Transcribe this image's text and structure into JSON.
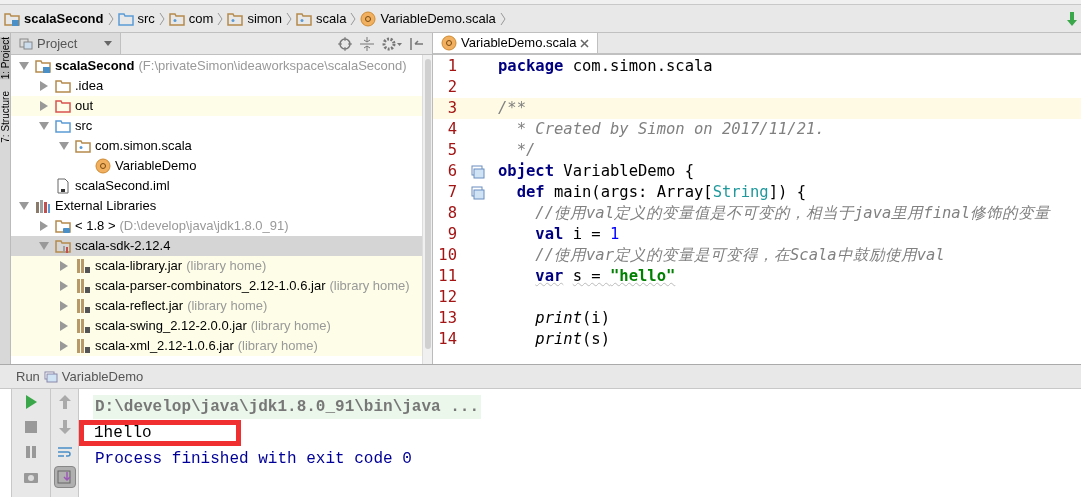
{
  "breadcrumbs": [
    {
      "label": "scalaSecond",
      "kind": "project"
    },
    {
      "label": "src",
      "kind": "source"
    },
    {
      "label": "com",
      "kind": "package"
    },
    {
      "label": "simon",
      "kind": "package"
    },
    {
      "label": "scala",
      "kind": "package"
    },
    {
      "label": "VariableDemo.scala",
      "kind": "object"
    }
  ],
  "side_tabs": [
    "1: Project",
    "7: Structure"
  ],
  "project_panel": {
    "title": "Project",
    "tree": [
      {
        "label": "scalaSecond",
        "hint": "(F:\\privateSimon\\ideaworkspace\\scalaSecond)",
        "kind": "project",
        "expanded": true,
        "selected": false,
        "highlighted": false,
        "children": [
          {
            "label": ".idea",
            "kind": "folder",
            "expanded": false,
            "selected": false,
            "highlighted": false
          },
          {
            "label": "out",
            "kind": "excluded",
            "expanded": false,
            "selected": false,
            "highlighted": true
          },
          {
            "label": "src",
            "kind": "source",
            "expanded": true,
            "selected": false,
            "highlighted": false,
            "children": [
              {
                "label": "com.simon.scala",
                "kind": "package",
                "expanded": true,
                "selected": false,
                "highlighted": false,
                "children": [
                  {
                    "label": "VariableDemo",
                    "kind": "object",
                    "selected": false,
                    "highlighted": false
                  }
                ]
              }
            ]
          },
          {
            "label": "scalaSecond.iml",
            "kind": "file",
            "selected": false,
            "highlighted": false
          }
        ]
      },
      {
        "label": "External Libraries",
        "kind": "libraries",
        "expanded": true,
        "selected": false,
        "highlighted": false,
        "children": [
          {
            "label": "< 1.8 >",
            "hint": "(D:\\develop\\java\\jdk1.8.0_91)",
            "kind": "jdk",
            "expanded": false,
            "selected": false,
            "highlighted": false
          },
          {
            "label": "scala-sdk-2.12.4",
            "kind": "sdk",
            "expanded": true,
            "selected": true,
            "highlighted": false,
            "children": [
              {
                "label": "scala-library.jar",
                "hint": "(library home)",
                "kind": "jar",
                "expanded": false,
                "selected": false,
                "highlighted": true
              },
              {
                "label": "scala-parser-combinators_2.12-1.0.6.jar",
                "hint": "(library home)",
                "kind": "jar",
                "expanded": false,
                "selected": false,
                "highlighted": true
              },
              {
                "label": "scala-reflect.jar",
                "hint": "(library home)",
                "kind": "jar",
                "expanded": false,
                "selected": false,
                "highlighted": true
              },
              {
                "label": "scala-swing_2.12-2.0.0.jar",
                "hint": "(library home)",
                "kind": "jar",
                "expanded": false,
                "selected": false,
                "highlighted": true
              },
              {
                "label": "scala-xml_2.12-1.0.6.jar",
                "hint": "(library home)",
                "kind": "jar",
                "expanded": false,
                "selected": false,
                "highlighted": true
              }
            ]
          }
        ]
      }
    ]
  },
  "editor": {
    "tabs": [
      {
        "label": "VariableDemo.scala",
        "selected": true
      }
    ],
    "lines": [
      {
        "number": "1",
        "current": false,
        "gutter_icon": false,
        "tokens": [
          {
            "text": "package",
            "kind": "keyword"
          },
          {
            "text": " com.simon.scala",
            "kind": "plain"
          }
        ]
      },
      {
        "number": "2",
        "current": false,
        "gutter_icon": false
      },
      {
        "number": "3",
        "current": true,
        "gutter_icon": false,
        "tokens": [
          {
            "text": "/**",
            "kind": "comment"
          }
        ]
      },
      {
        "number": "4",
        "current": false,
        "gutter_icon": false,
        "tokens": [
          {
            "text": "  * Created by Simon on 2017/11/21.",
            "kind": "comment"
          }
        ]
      },
      {
        "number": "5",
        "current": false,
        "gutter_icon": false,
        "tokens": [
          {
            "text": "  */",
            "kind": "comment"
          }
        ]
      },
      {
        "number": "6",
        "current": false,
        "gutter_icon": true,
        "tokens": [
          {
            "text": "object",
            "kind": "keyword"
          },
          {
            "text": " VariableDemo {",
            "kind": "plain"
          }
        ]
      },
      {
        "number": "7",
        "current": false,
        "gutter_icon": true,
        "tokens": [
          {
            "text": "  def",
            "kind": "keyword"
          },
          {
            "text": " main(args: Array[",
            "kind": "plain"
          },
          {
            "text": "String",
            "kind": "type"
          },
          {
            "text": "]) {",
            "kind": "plain"
          }
        ]
      },
      {
        "number": "8",
        "current": false,
        "gutter_icon": false,
        "tokens": [
          {
            "text": "    //使用val定义的变量值是不可变的，相当于java里用final修饰的变量",
            "kind": "comment"
          }
        ]
      },
      {
        "number": "9",
        "current": false,
        "gutter_icon": false,
        "tokens": [
          {
            "text": "    val",
            "kind": "keyword"
          },
          {
            "text": " i = ",
            "kind": "plain"
          },
          {
            "text": "1",
            "kind": "number"
          }
        ]
      },
      {
        "number": "10",
        "current": false,
        "gutter_icon": false,
        "tokens": [
          {
            "text": "    //使用var定义的变量是可变得，在Scala中鼓励使用val",
            "kind": "comment"
          }
        ]
      },
      {
        "number": "11",
        "current": false,
        "gutter_icon": false,
        "tokens": [
          {
            "text": "    var",
            "kind": "keyword",
            "warning": true
          },
          {
            "text": " s = ",
            "kind": "plain",
            "warning": true
          },
          {
            "text": "\"hello\"",
            "kind": "string",
            "warning": true
          }
        ]
      },
      {
        "number": "12",
        "current": false,
        "gutter_icon": false
      },
      {
        "number": "13",
        "current": false,
        "gutter_icon": false,
        "tokens": [
          {
            "text": "    print",
            "kind": "call"
          },
          {
            "text": "(i)",
            "kind": "plain"
          }
        ]
      },
      {
        "number": "14",
        "current": false,
        "gutter_icon": false,
        "tokens": [
          {
            "text": "    print",
            "kind": "call"
          },
          {
            "text": "(s)",
            "kind": "plain"
          }
        ]
      }
    ]
  },
  "run_panel": {
    "label": "Run",
    "config": "VariableDemo",
    "tools": [
      {
        "kind": "run"
      },
      {
        "kind": "stop"
      },
      {
        "kind": "pause"
      },
      {
        "kind": "camera"
      }
    ],
    "tools_2": [
      {
        "kind": "up",
        "selected": false
      },
      {
        "kind": "down",
        "selected": false
      },
      {
        "kind": "wrap",
        "selected": false
      },
      {
        "kind": "scroll-end",
        "selected": true
      }
    ],
    "console": [
      {
        "text": "D:\\develop\\java\\jdk1.8.0_91\\bin\\java ...",
        "kind": "command",
        "marked": false
      },
      {
        "text": "1hello",
        "kind": "output",
        "marked": true
      },
      {
        "text": "Process finished with exit code 0",
        "kind": "system",
        "marked": false
      }
    ]
  }
}
